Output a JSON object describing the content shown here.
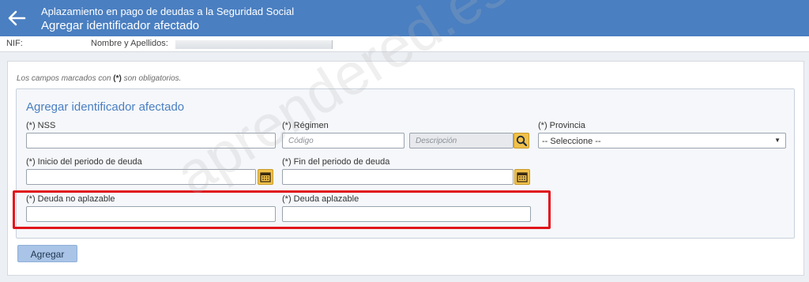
{
  "header": {
    "title": "Aplazamiento en pago de deudas a la Seguridad Social",
    "subtitle": "Agregar identificador afectado",
    "back_icon": "arrow-left-icon"
  },
  "infobar": {
    "nif_label": "NIF:",
    "name_label": "Nombre y Apellidos:"
  },
  "form": {
    "note_prefix": "Los campos marcados con ",
    "note_marker": "(*)",
    "note_suffix": " son obligatorios.",
    "legend": "Agregar identificador afectado",
    "nss_label": "(*) NSS",
    "regimen_label": "(*) Régimen",
    "codigo_placeholder": "Código",
    "descripcion_placeholder": "Descripción",
    "provincia_label": "(*) Provincia",
    "provincia_selected": "-- Seleccione --",
    "inicio_label": "(*) Inicio del periodo de deuda",
    "fin_label": "(*) Fin del periodo de deuda",
    "deuda_no_aplazable_label": "(*) Deuda no aplazable",
    "deuda_aplazable_label": "(*) Deuda aplazable",
    "add_button": "Agregar"
  },
  "watermark": "aprendered.es",
  "colors": {
    "header_bg": "#4a7fc1",
    "highlight": "#e0141b",
    "icon_button": "#f0c14b",
    "add_button": "#a9c4e6"
  }
}
